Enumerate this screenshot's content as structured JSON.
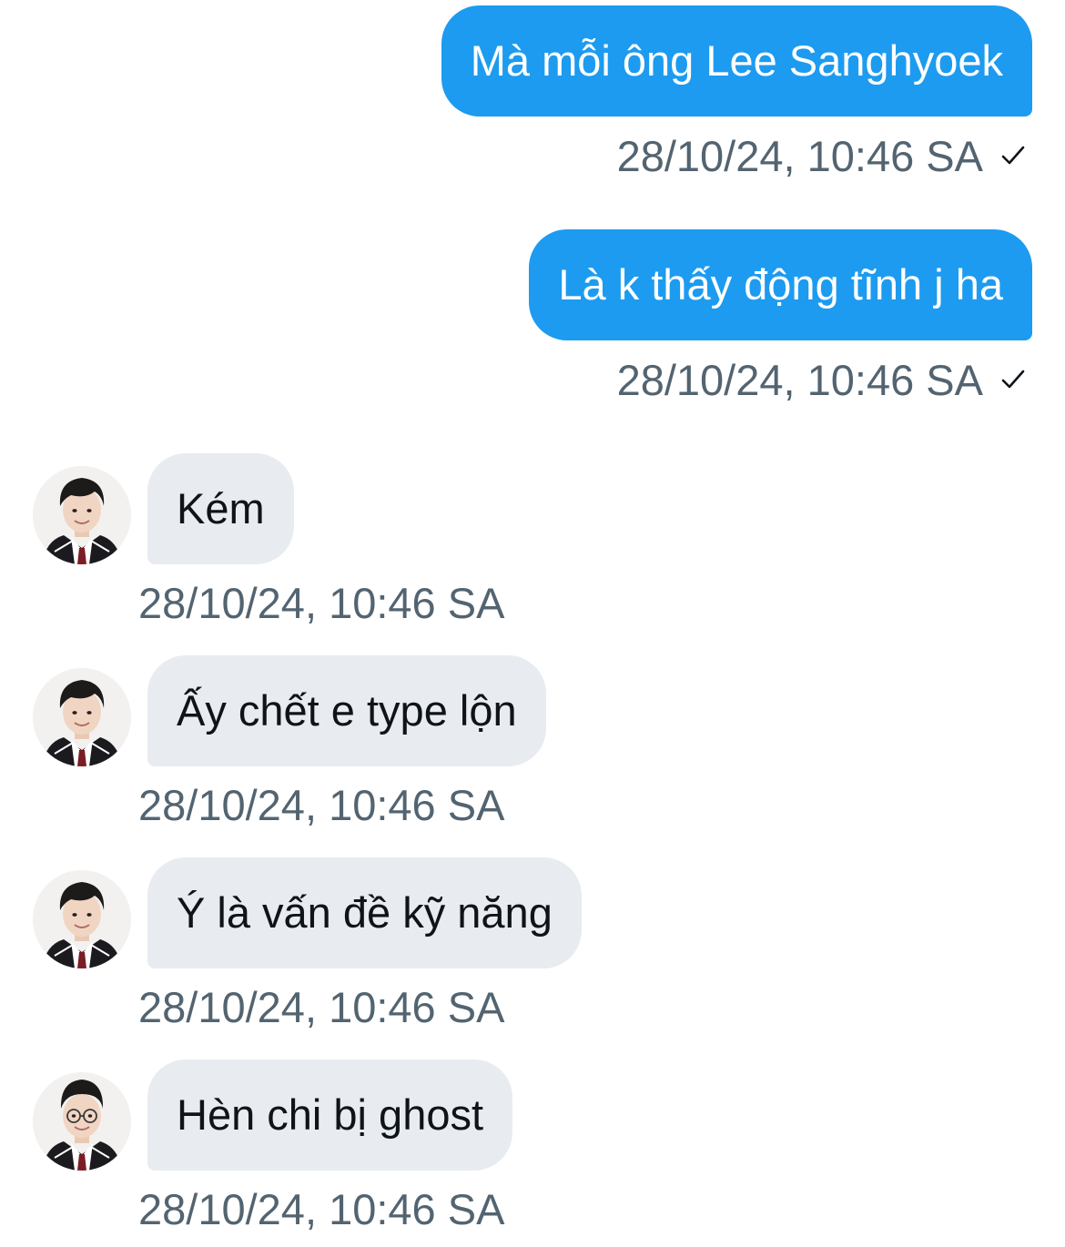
{
  "colors": {
    "sent_bubble": "#1d9bf0",
    "received_bubble": "#e8ecf0",
    "timestamp": "#536471",
    "text_dark": "#0f1419"
  },
  "messages": [
    {
      "direction": "sent",
      "text": "Mà mỗi ông Lee Sanghyoek",
      "time": "28/10/24, 10:46 SA",
      "status_icon": "check-icon"
    },
    {
      "direction": "sent",
      "text": "Là k thấy động tĩnh j ha",
      "time": "28/10/24, 10:46 SA",
      "status_icon": "check-icon"
    },
    {
      "direction": "received",
      "text": "Kém",
      "time": "28/10/24, 10:46 SA",
      "avatar": "avatar-icon"
    },
    {
      "direction": "received",
      "text": "Ấy chết e type lộn",
      "time": "28/10/24, 10:46 SA",
      "avatar": "avatar-icon"
    },
    {
      "direction": "received",
      "text": "Ý là vấn đề kỹ năng",
      "time": "28/10/24, 10:46 SA",
      "avatar": "avatar-icon"
    },
    {
      "direction": "received",
      "text": "Hèn chi bị ghost",
      "time": "28/10/24, 10:46 SA",
      "avatar": "avatar-glasses-icon"
    }
  ]
}
